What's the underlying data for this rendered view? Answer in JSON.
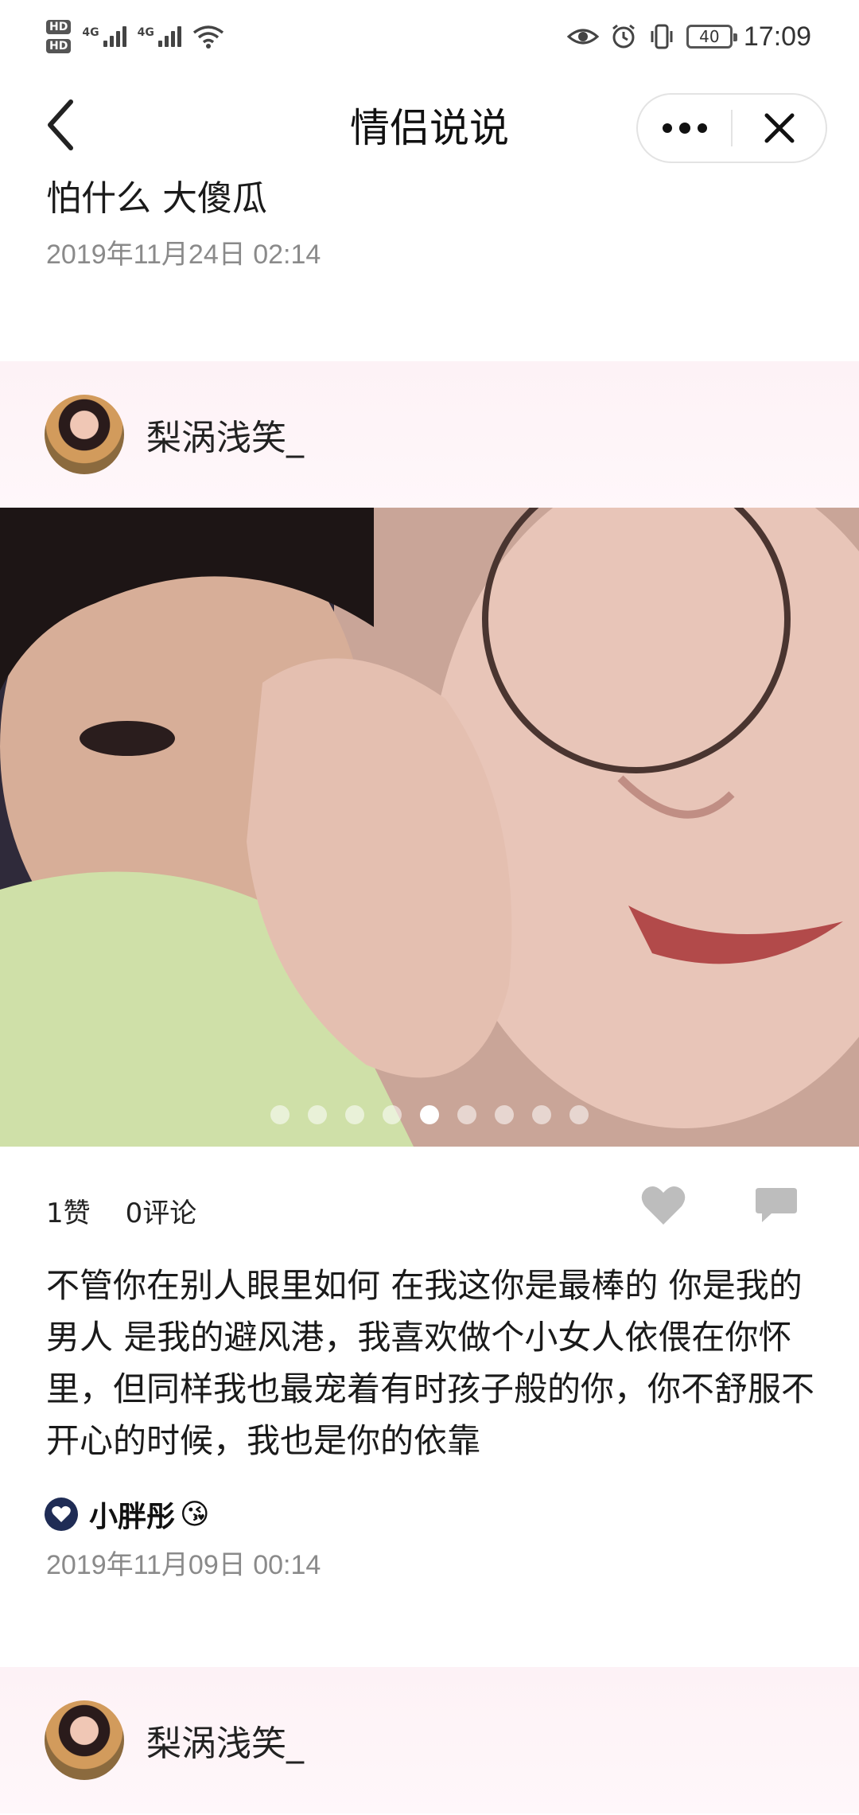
{
  "status_bar": {
    "hd1": "HD",
    "hd2": "HD",
    "net1": "4G",
    "net2": "4G",
    "battery": "40",
    "time": "17:09"
  },
  "nav": {
    "title": "情侣说说",
    "more_icon": "more-dots-icon",
    "close_icon": "close-x-icon",
    "back_icon": "chevron-left-icon"
  },
  "prev_post": {
    "text": "怕什么 大傻瓜",
    "time": "2019年11月24日 02:14"
  },
  "post": {
    "username": "梨涡浅笑_",
    "photo_count": 9,
    "active_photo_index": 4,
    "likes": "1赞",
    "comments": "0评论",
    "body": "不管你在别人眼里如何 在我这你是最棒的 你是我的男人 是我的避风港，我喜欢做个小女人依偎在你怀里，但同样我也最宠着有时孩子般的你，你不舒服不开心的时候，我也是你的依靠",
    "tag_name": "小胖彤",
    "tag_emoji": "😘",
    "time": "2019年11月09日 00:14"
  },
  "next_post": {
    "username": "梨涡浅笑_"
  },
  "colors": {
    "header_bg": "#fdf2f6",
    "timestamp": "#8a8a8a",
    "icon_gray": "#bdbdbd",
    "badge_navy": "#1f2c55"
  }
}
